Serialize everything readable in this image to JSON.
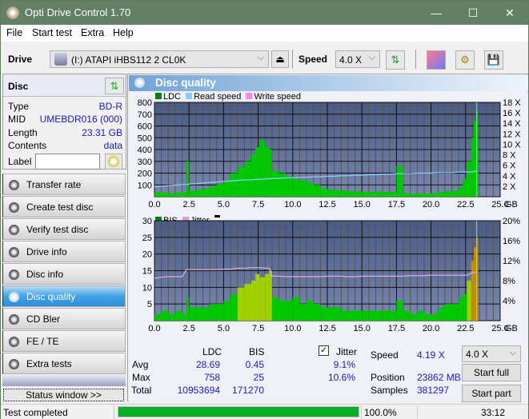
{
  "window": {
    "title": "Opti Drive Control 1.70",
    "minimize": "—",
    "maximize": "☐",
    "close": "✕"
  },
  "menu": [
    {
      "label": "File"
    },
    {
      "label": "Start test"
    },
    {
      "label": "Extra"
    },
    {
      "label": "Help"
    }
  ],
  "toolbar": {
    "drive_label": "Drive",
    "drive_value": "(I:)  ATAPI iHBS112  2 CL0K",
    "speed_label": "Speed",
    "speed_value": "4.0 X",
    "icons": [
      "eject-icon",
      "refresh-icon",
      "eraser-icon",
      "settings-icon",
      "save-icon"
    ]
  },
  "disc": {
    "title": "Disc",
    "fields": [
      {
        "key": "Type",
        "value": "BD-R"
      },
      {
        "key": "MID",
        "value": "UMEBDR016 (000)"
      },
      {
        "key": "Length",
        "value": "23.31 GB"
      },
      {
        "key": "Contents",
        "value": "data"
      }
    ],
    "label_key": "Label",
    "label_value": ""
  },
  "nav": [
    {
      "label": "Transfer rate",
      "active": false
    },
    {
      "label": "Create test disc",
      "active": false
    },
    {
      "label": "Verify test disc",
      "active": false
    },
    {
      "label": "Drive info",
      "active": false
    },
    {
      "label": "Disc info",
      "active": false
    },
    {
      "label": "Disc quality",
      "active": true
    },
    {
      "label": "CD Bler",
      "active": false
    },
    {
      "label": "FE / TE",
      "active": false
    },
    {
      "label": "Extra tests",
      "active": false
    }
  ],
  "status_window_label": "Status window >>",
  "panel_title": "Disc quality",
  "chart_data": [
    {
      "type": "bar",
      "title": "LDC",
      "legend": [
        "LDC",
        "Read speed",
        "Write speed"
      ],
      "legend_colors": {
        "LDC": "#008000",
        "Read speed": "#87cefa",
        "Write speed": "#ff80ff"
      },
      "xlabel": "GB",
      "x_ticks": [
        "0.0",
        "2.5",
        "5.0",
        "7.5",
        "10.0",
        "12.5",
        "15.0",
        "17.5",
        "20.0",
        "22.5",
        "25.0"
      ],
      "y_ticks_left": [
        "100",
        "200",
        "300",
        "400",
        "500",
        "600",
        "700",
        "800"
      ],
      "y_ticks_right": [
        "2 X",
        "4 X",
        "6 X",
        "8 X",
        "10 X",
        "12 X",
        "14 X",
        "16 X",
        "18 X"
      ],
      "xlim": [
        0,
        25
      ],
      "ylim": [
        0,
        800
      ],
      "y2lim": [
        0,
        18
      ],
      "x": [
        0,
        0.5,
        1,
        1.5,
        2,
        2.3,
        2.5,
        3,
        3.5,
        4,
        4.5,
        5,
        5.5,
        6,
        6.5,
        7,
        7.3,
        7.6,
        8,
        8.3,
        8.5,
        9,
        9.5,
        10,
        10.5,
        11,
        11.5,
        12,
        12.5,
        13,
        13.5,
        14,
        14.5,
        15,
        15.5,
        16,
        16.5,
        17,
        17.5,
        18,
        18.5,
        19,
        19.5,
        20,
        20.5,
        21,
        21.5,
        22,
        22.3,
        22.6,
        22.9,
        23.1,
        23.3
      ],
      "ldc": [
        40,
        35,
        30,
        35,
        40,
        300,
        50,
        60,
        70,
        90,
        110,
        140,
        200,
        250,
        300,
        360,
        420,
        480,
        420,
        400,
        220,
        200,
        170,
        150,
        140,
        120,
        100,
        70,
        60,
        55,
        50,
        45,
        45,
        40,
        40,
        45,
        40,
        40,
        260,
        30,
        25,
        30,
        25,
        30,
        40,
        45,
        50,
        80,
        150,
        300,
        500,
        640,
        730
      ],
      "read_speed": [
        1.9,
        2.0,
        2.1,
        2.2,
        2.3,
        2.3,
        2.4,
        2.5,
        2.6,
        2.7,
        2.8,
        2.9,
        3.0,
        3.1,
        3.2,
        3.2,
        3.3,
        3.3,
        3.4,
        3.4,
        3.5,
        3.5,
        3.6,
        3.6,
        3.7,
        3.7,
        3.8,
        3.8,
        3.9,
        3.9,
        4.0,
        4.0,
        4.1,
        4.1,
        4.2,
        4.2,
        4.3,
        4.3,
        4.4,
        4.4,
        4.4,
        4.5,
        4.5,
        4.5,
        4.6,
        4.6,
        4.6,
        4.7,
        4.7,
        4.7,
        4.7,
        4.8,
        4.9
      ],
      "write_speed": []
    },
    {
      "type": "bar",
      "title": "BIS",
      "legend": [
        "BIS",
        "Jitter"
      ],
      "legend_colors": {
        "BIS": "#008000",
        "Jitter": "#d8a0d8"
      },
      "xlabel": "GB",
      "x_ticks": [
        "0.0",
        "2.5",
        "5.0",
        "7.5",
        "10.0",
        "12.5",
        "15.0",
        "17.5",
        "20.0",
        "22.5",
        "25.0"
      ],
      "y_ticks_left": [
        "5",
        "10",
        "15",
        "20",
        "25",
        "30"
      ],
      "y_ticks_right": [
        "4%",
        "8%",
        "12%",
        "16%",
        "20%"
      ],
      "xlim": [
        0,
        25
      ],
      "ylim": [
        0,
        30
      ],
      "y2lim": [
        0,
        20
      ],
      "x": [
        0,
        0.5,
        1,
        1.5,
        2,
        2.3,
        2.5,
        3,
        3.5,
        4,
        4.5,
        5,
        5.5,
        6,
        6.5,
        7,
        7.3,
        7.6,
        8,
        8.3,
        8.5,
        9,
        9.5,
        10,
        10.5,
        11,
        11.5,
        12,
        12.5,
        13,
        13.5,
        14,
        14.5,
        15,
        15.5,
        16,
        16.5,
        17,
        17.5,
        18,
        18.5,
        19,
        19.5,
        20,
        20.5,
        21,
        21.5,
        22,
        22.3,
        22.6,
        22.9,
        23.1,
        23.3
      ],
      "bis": [
        2,
        3,
        2,
        3,
        2,
        7,
        4,
        4,
        4,
        5,
        5,
        6,
        8,
        10,
        11,
        12,
        14,
        13,
        14,
        15,
        7,
        6,
        6,
        7,
        5,
        6,
        5,
        4,
        4,
        4,
        3,
        3,
        3,
        3,
        3,
        3,
        3,
        3,
        6,
        3,
        2,
        3,
        2,
        2,
        4,
        5,
        5,
        7,
        8,
        12,
        18,
        22,
        25
      ],
      "jitter": [
        8.5,
        8.7,
        8.8,
        8.8,
        8.8,
        10.2,
        10.2,
        10.2,
        10.2,
        10.2,
        10.2,
        10.3,
        10.3,
        10.5,
        10.5,
        10.6,
        10.6,
        10.6,
        10.5,
        10.5,
        8.9,
        8.9,
        8.8,
        8.8,
        8.8,
        8.8,
        8.8,
        8.8,
        8.9,
        8.9,
        8.9,
        8.8,
        8.8,
        8.9,
        8.9,
        8.9,
        8.9,
        8.9,
        8.9,
        8.9,
        9.0,
        9.0,
        9.0,
        9.1,
        9.1,
        9.1,
        9.1,
        9.1,
        9.1,
        9.1,
        9.5,
        9.6,
        9.6
      ]
    }
  ],
  "stats": {
    "col_ldc": "LDC",
    "col_bis": "BIS",
    "jitter_label": "Jitter",
    "jitter_checked": true,
    "rows": [
      {
        "label": "Avg",
        "ldc": "28.69",
        "bis": "0.45",
        "jitter": "9.1%"
      },
      {
        "label": "Max",
        "ldc": "758",
        "bis": "25",
        "jitter": "10.6%"
      },
      {
        "label": "Total",
        "ldc": "10953694",
        "bis": "171270",
        "jitter": ""
      }
    ],
    "speed_label": "Speed",
    "speed_value": "4.19 X",
    "position_label": "Position",
    "position_value": "23862 MB",
    "samples_label": "Samples",
    "samples_value": "381297",
    "speed_select": "4.0 X",
    "start_full": "Start full",
    "start_part": "Start part"
  },
  "statusbar": {
    "message": "Test completed",
    "progress": 100.0,
    "progress_text": "100.0%",
    "time": "33:12"
  }
}
